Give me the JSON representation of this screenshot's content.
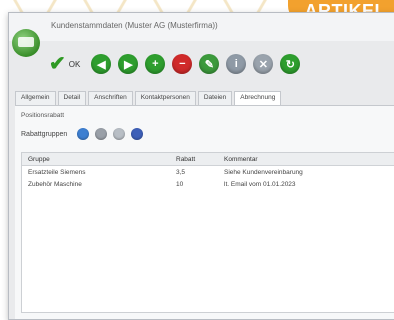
{
  "tag": {
    "label": "ARTIKEL"
  },
  "window": {
    "title": "Kundenstammdaten (Muster AG (Musterfirma))"
  },
  "toolbar": {
    "ok_label": "OK",
    "buttons": [
      {
        "name": "back",
        "color": "#2e9e2e",
        "icon": "arrow-left-icon"
      },
      {
        "name": "forward",
        "color": "#2e9e2e",
        "icon": "arrow-right-icon"
      },
      {
        "name": "add",
        "color": "#2e9e2e",
        "icon": "plus-icon"
      },
      {
        "name": "delete",
        "color": "#d02a2a",
        "icon": "minus-icon"
      },
      {
        "name": "edit",
        "color": "#3c9a3c",
        "icon": "pencil-icon"
      },
      {
        "name": "info",
        "color": "#8f9aa6",
        "icon": "info-icon"
      },
      {
        "name": "close",
        "color": "#9aa3ad",
        "icon": "x-icon"
      },
      {
        "name": "refresh",
        "color": "#2e9e2e",
        "icon": "refresh-icon"
      }
    ]
  },
  "tabs": [
    "Allgemein",
    "Detail",
    "Anschriften",
    "Kontaktpersonen",
    "Dateien",
    "Abrechnung"
  ],
  "section": {
    "label": "Positionsrabatt"
  },
  "subtoolbar": {
    "label": "Rabattgruppen",
    "buttons": [
      {
        "color": "#3d7fd1"
      },
      {
        "color": "#9aa0a8"
      },
      {
        "color": "#b8bec5"
      },
      {
        "color": "#3d5fb8"
      }
    ]
  },
  "grid": {
    "columns": [
      "Gruppe",
      "Rabatt",
      "Kommentar"
    ],
    "rows": [
      {
        "group": "Ersatzteile Siemens",
        "discount": "3,5",
        "comment": "Siehe Kundenvereinbarung"
      },
      {
        "group": "Zubehör Maschine",
        "discount": "10",
        "comment": "lt. Email vom 01.01.2023"
      }
    ]
  }
}
